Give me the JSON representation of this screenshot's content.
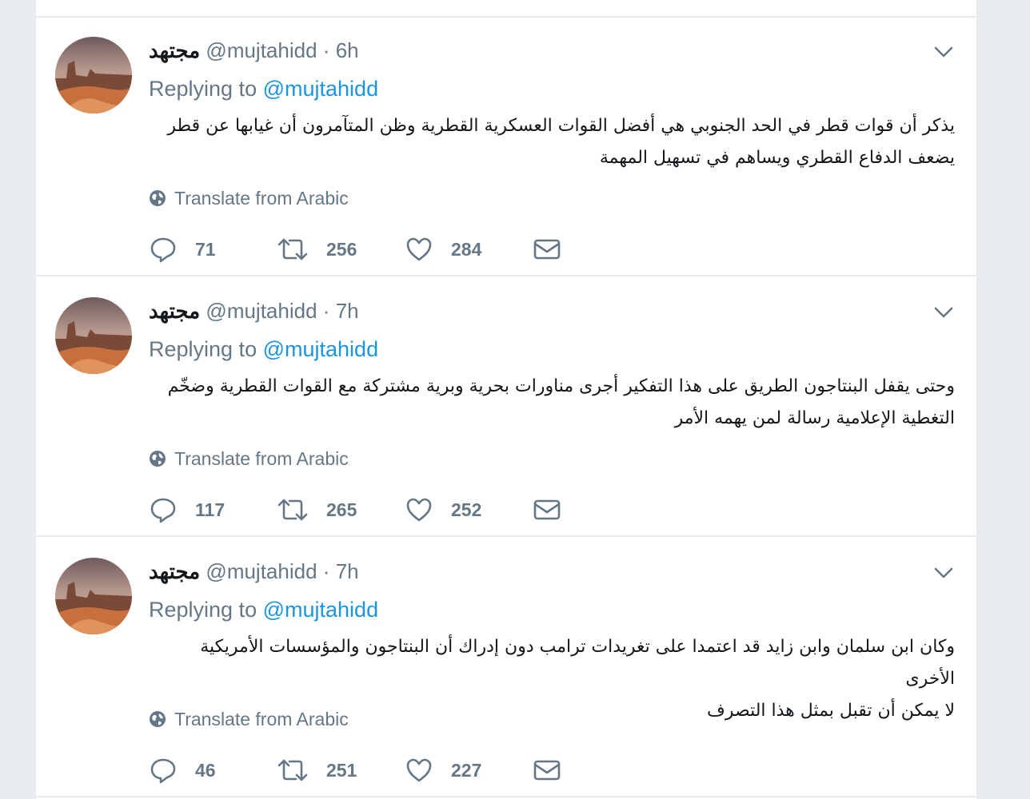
{
  "tweets": [
    {
      "fullname": "مجتهد",
      "handle": "@mujtahidd",
      "separator": "·",
      "time": "6h",
      "replying_prefix": "Replying to",
      "replying_handle": "@mujtahidd",
      "line1": "يذكر أن قوات قطر في الحد الجنوبي هي أفضل القوات العسكرية القطرية وظن المتآمرون أن غيابها عن قطر",
      "line2": "يضعف الدفاع القطري ويساهم في تسهيل المهمة",
      "translate": "Translate from Arabic",
      "replies": "71",
      "retweets": "256",
      "likes": "284"
    },
    {
      "fullname": "مجتهد",
      "handle": "@mujtahidd",
      "separator": "·",
      "time": "7h",
      "replying_prefix": "Replying to",
      "replying_handle": "@mujtahidd",
      "line1": "وحتى يقفل البنتاجون الطريق على هذا التفكير أجرى مناورات بحرية وبرية مشتركة مع القوات القطرية وضخّم",
      "line2": "التغطية الإعلامية رسالة لمن يهمه الأمر",
      "translate": "Translate from Arabic",
      "replies": "117",
      "retweets": "265",
      "likes": "252"
    },
    {
      "fullname": "مجتهد",
      "handle": "@mujtahidd",
      "separator": "·",
      "time": "7h",
      "replying_prefix": "Replying to",
      "replying_handle": "@mujtahidd",
      "line1": "وكان ابن سلمان وابن زايد قد اعتمدا على تغريدات ترامب دون إدراك أن البنتاجون والمؤسسات الأمريكية الأخرى",
      "line2": "لا يمكن أن تقبل بمثل هذا التصرف",
      "translate": "Translate from Arabic",
      "replies": "46",
      "retweets": "251",
      "likes": "227"
    }
  ],
  "icons": {
    "reply": "reply-icon",
    "retweet": "retweet-icon",
    "like": "heart-icon",
    "dm": "envelope-icon",
    "caret": "chevron-down-icon",
    "globe": "globe-icon"
  },
  "colors": {
    "link": "#1b95e0",
    "muted": "#657786",
    "text": "#14171a",
    "background": "#e6ecf0"
  }
}
